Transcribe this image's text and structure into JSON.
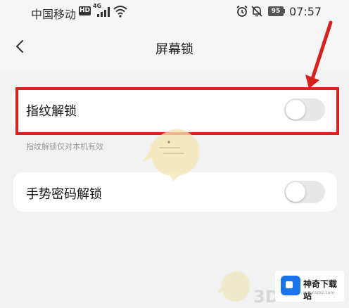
{
  "status_bar": {
    "carrier": "中国移动",
    "hd": "HD",
    "network": "4G",
    "battery": "95",
    "time": "07:57"
  },
  "header": {
    "title": "屏幕锁"
  },
  "settings": {
    "fingerprint": {
      "label": "指纹解锁",
      "enabled": false,
      "hint": "指纹解锁仅对本机有效"
    },
    "gesture": {
      "label": "手势密码解锁",
      "enabled": false
    }
  },
  "annotation": {
    "highlight_color": "#d7211c"
  },
  "watermark": {
    "text_3d": "3D",
    "site_name": "神奇下载站",
    "site_url": "www.sqxz.com"
  }
}
